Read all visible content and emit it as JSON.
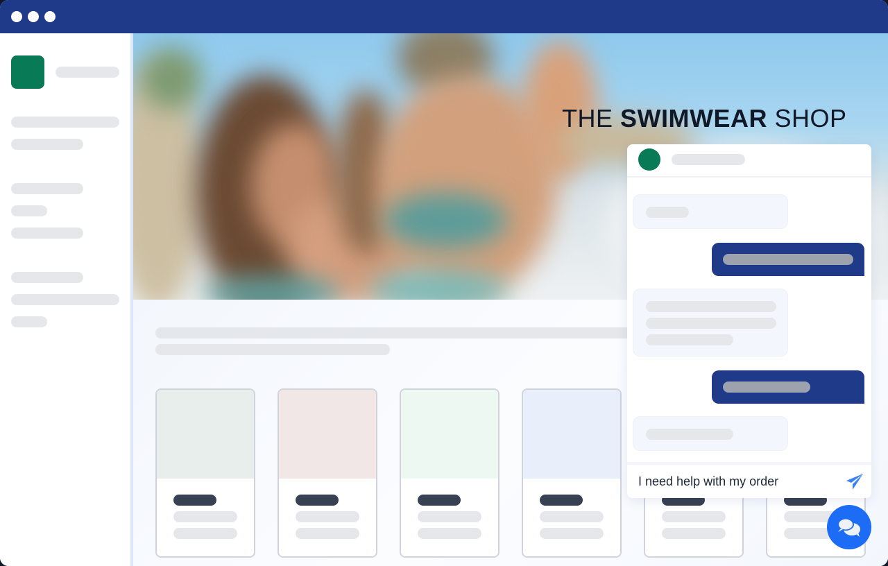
{
  "window": {
    "title_dots": [
      "close",
      "minimize",
      "maximize"
    ],
    "colors": {
      "titlebar": "#203a8a",
      "brand_green": "#087a56",
      "accent_blue": "#1d6cf6"
    }
  },
  "sidebar": {
    "logo_icon": "store-logo-icon",
    "skeleton_groups": [
      3,
      3,
      3
    ]
  },
  "hero": {
    "title_prefix": "THE ",
    "title_bold": "SWIMWEAR",
    "title_suffix": " SHOP",
    "image": "blurred-beach-swimwear-photo"
  },
  "products": [
    {
      "tint": "#e8eeeb"
    },
    {
      "tint": "#f2e7e7"
    },
    {
      "tint": "#edf8f2"
    },
    {
      "tint": "#e9eefb"
    },
    {
      "tint": "#ffffff"
    },
    {
      "tint": "#ffffff"
    }
  ],
  "chat": {
    "agent_avatar": "agent-avatar",
    "messages": [
      {
        "from": "agent",
        "lines": 1
      },
      {
        "from": "user",
        "lines": 1
      },
      {
        "from": "agent",
        "lines": 3
      },
      {
        "from": "user",
        "lines": 1
      },
      {
        "from": "agent",
        "lines": 1
      }
    ],
    "input_value": "I need help with my order",
    "send_icon": "paper-plane-icon"
  },
  "launcher": {
    "icon": "chat-bubbles-icon"
  }
}
